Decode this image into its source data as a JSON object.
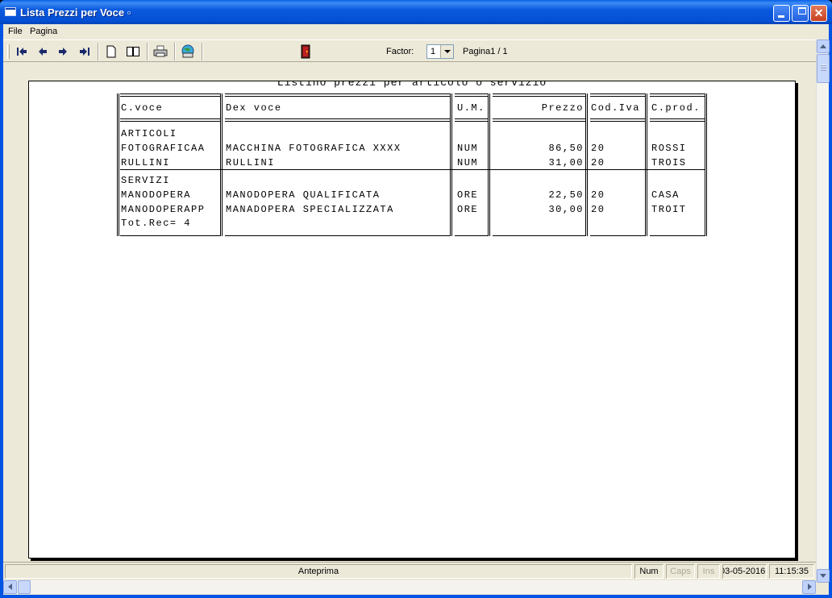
{
  "window": {
    "title": "Lista Prezzi per Voce",
    "title_marker": "▫"
  },
  "menu": [
    "File",
    "Pagina"
  ],
  "toolbar": {
    "icons": [
      "first-page-icon",
      "previous-page-icon",
      "next-page-icon",
      "last-page-icon",
      "single-page-icon",
      "two-pages-icon",
      "print-icon",
      "export-icon",
      "exit-door-icon"
    ],
    "factor_label": "Factor:",
    "factor_value": "1",
    "page_info": "Pagina1 / 1"
  },
  "report": {
    "title": "Listino prezzi per articolo o servizio",
    "columns": [
      "C.voce",
      "Dex voce",
      "U.M.",
      "Prezzo",
      "Cod.Iva",
      "C.prod."
    ],
    "groups": [
      {
        "name": "ARTICOLI",
        "rows": [
          {
            "code": "FOTOGRAFICAA",
            "desc": "MACCHINA FOTOGRAFICA XXXX",
            "um": "NUM",
            "price": "86,50",
            "iva": "20",
            "prod": "ROSSI"
          },
          {
            "code": "RULLINI",
            "desc": "RULLINI",
            "um": "NUM",
            "price": "31,00",
            "iva": "20",
            "prod": "TROIS"
          }
        ]
      },
      {
        "name": "SERVIZI",
        "rows": [
          {
            "code": "MANODOPERA",
            "desc": "MANODOPERA QUALIFICATA",
            "um": "ORE",
            "price": "22,50",
            "iva": "20",
            "prod": "CASA"
          },
          {
            "code": "MANODOPERAPP",
            "desc": "MANADOPERA SPECIALIZZATA",
            "um": "ORE",
            "price": "30,00",
            "iva": "20",
            "prod": "TROIT"
          }
        ]
      }
    ],
    "total": "Tot.Rec= 4"
  },
  "statusbar": {
    "main": "Anteprima",
    "num": "Num",
    "caps": "Caps",
    "ins": "Ins",
    "date": "03-05-2016",
    "time": "11:15:35"
  },
  "colors": {
    "title_bar": "#0054e3",
    "chrome": "#ece9d8",
    "close_button": "#c8401f"
  }
}
